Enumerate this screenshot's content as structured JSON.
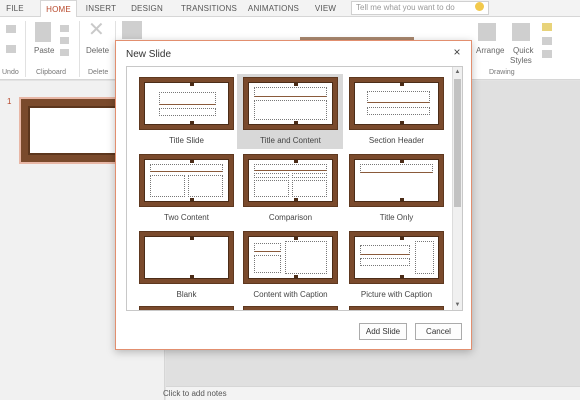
{
  "ribbon": {
    "tabs": [
      "FILE",
      "HOME",
      "INSERT",
      "DESIGN",
      "TRANSITIONS",
      "ANIMATIONS",
      "VIEW"
    ],
    "active_tab": "HOME",
    "tell_me_placeholder": "Tell me what you want to do",
    "groups": {
      "undo_label": "Undo",
      "clipboard_label": "Clipboard",
      "delete_group_label": "Delete",
      "drawing_label": "Drawing"
    },
    "buttons": {
      "paste": "Paste",
      "delete": "Delete",
      "arrange": "Arrange",
      "quick_styles_line1": "Quick",
      "quick_styles_line2": "Styles"
    }
  },
  "thumbnail_pane": {
    "slide_number": "1"
  },
  "notes": {
    "placeholder": "Click to add notes"
  },
  "dialog": {
    "title": "New Slide",
    "close": "×",
    "layouts": [
      {
        "label": "Title Slide"
      },
      {
        "label": "Title and Content",
        "selected": true
      },
      {
        "label": "Section Header"
      },
      {
        "label": "Two Content"
      },
      {
        "label": "Comparison"
      },
      {
        "label": "Title Only"
      },
      {
        "label": "Blank"
      },
      {
        "label": "Content with Caption"
      },
      {
        "label": "Picture with Caption"
      }
    ],
    "add_button": "Add Slide",
    "cancel_button": "Cancel"
  },
  "colors": {
    "accent": "#b7472a",
    "wood": "#7a4a2c",
    "dialog_border": "#e28f6f",
    "selected_tile": "#d8d8d8"
  }
}
